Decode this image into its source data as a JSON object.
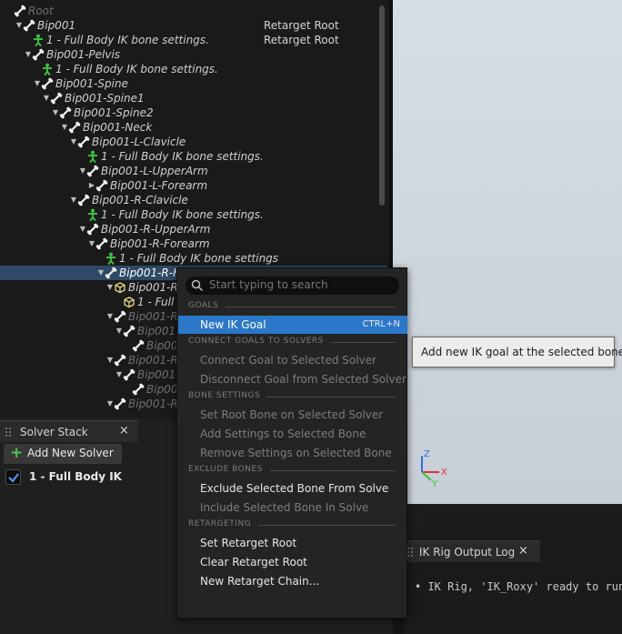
{
  "hierarchy": {
    "rows": [
      {
        "label": "Root",
        "depth": 0,
        "icon": "bone-icon",
        "arrow": "none",
        "dim": true
      },
      {
        "label": "Bip001",
        "depth": 1,
        "icon": "bone-icon",
        "arrow": "open",
        "goal_text": "Retarget Root"
      },
      {
        "label": "1 - Full Body IK bone settings.",
        "depth": 2,
        "icon": "bone-settings-icon",
        "arrow": "none",
        "goal_text": "Retarget Root"
      },
      {
        "label": "Bip001-Pelvis",
        "depth": 2,
        "icon": "bone-icon",
        "arrow": "open"
      },
      {
        "label": "1 - Full Body IK bone settings.",
        "depth": 3,
        "icon": "bone-settings-icon",
        "arrow": "none"
      },
      {
        "label": "Bip001-Spine",
        "depth": 3,
        "icon": "bone-icon",
        "arrow": "open"
      },
      {
        "label": "Bip001-Spine1",
        "depth": 4,
        "icon": "bone-icon",
        "arrow": "open"
      },
      {
        "label": "Bip001-Spine2",
        "depth": 5,
        "icon": "bone-icon",
        "arrow": "open"
      },
      {
        "label": "Bip001-Neck",
        "depth": 6,
        "icon": "bone-icon",
        "arrow": "open"
      },
      {
        "label": "Bip001-L-Clavicle",
        "depth": 7,
        "icon": "bone-icon",
        "arrow": "open"
      },
      {
        "label": "1 - Full Body IK bone settings.",
        "depth": 8,
        "icon": "bone-settings-icon",
        "arrow": "none"
      },
      {
        "label": "Bip001-L-UpperArm",
        "depth": 8,
        "icon": "bone-icon",
        "arrow": "open"
      },
      {
        "label": "Bip001-L-Forearm",
        "depth": 9,
        "icon": "bone-icon",
        "arrow": "closed"
      },
      {
        "label": "Bip001-R-Clavicle",
        "depth": 7,
        "icon": "bone-icon",
        "arrow": "open"
      },
      {
        "label": "1 - Full Body IK bone settings.",
        "depth": 8,
        "icon": "bone-settings-icon",
        "arrow": "none"
      },
      {
        "label": "Bip001-R-UpperArm",
        "depth": 8,
        "icon": "bone-icon",
        "arrow": "open"
      },
      {
        "label": "Bip001-R-Forearm",
        "depth": 9,
        "icon": "bone-icon",
        "arrow": "open"
      },
      {
        "label": "1 - Full Body IK bone settings",
        "depth": 10,
        "icon": "bone-settings-icon",
        "arrow": "none"
      },
      {
        "label": "Bip001-R-H",
        "depth": 10,
        "icon": "bone-icon",
        "arrow": "open",
        "selected": true
      },
      {
        "label": "Bip001-R",
        "depth": 11,
        "icon": "goal-cube-icon",
        "arrow": "open"
      },
      {
        "label": "1 - Full B",
        "depth": 12,
        "icon": "goal-cube-icon",
        "arrow": "none"
      },
      {
        "label": "Bip001-R",
        "depth": 11,
        "icon": "bone-icon",
        "arrow": "open",
        "dim": true
      },
      {
        "label": "Bip001-",
        "depth": 12,
        "icon": "bone-icon",
        "arrow": "open",
        "dim": true
      },
      {
        "label": "Bip001",
        "depth": 13,
        "icon": "bone-icon",
        "arrow": "none",
        "dim": true
      },
      {
        "label": "Bip001-R",
        "depth": 11,
        "icon": "bone-icon",
        "arrow": "open",
        "dim": true
      },
      {
        "label": "Bip001-",
        "depth": 12,
        "icon": "bone-icon",
        "arrow": "open",
        "dim": true
      },
      {
        "label": "Bip001",
        "depth": 13,
        "icon": "bone-icon",
        "arrow": "none",
        "dim": true
      },
      {
        "label": "Bip001-R",
        "depth": 11,
        "icon": "bone-icon",
        "arrow": "open",
        "dim": true
      }
    ]
  },
  "solver_stack": {
    "tab_title": "Solver Stack",
    "close_glyph": "×",
    "add_button_label": "Add New Solver",
    "add_glyph": "+",
    "solvers": [
      {
        "label": "1 - Full Body IK",
        "enabled": true
      }
    ]
  },
  "output_log": {
    "tab_title": "IK Rig Output Log",
    "close_glyph": "×",
    "lines": [
      "• IK Rig, 'IK_Roxy' ready to run"
    ]
  },
  "context_menu": {
    "search_placeholder": "Start typing to search",
    "sections": [
      {
        "title": "GOALS",
        "items": [
          {
            "label": "New IK Goal",
            "shortcut": "CTRL+N",
            "enabled": true,
            "highlighted": true
          }
        ]
      },
      {
        "title": "CONNECT GOALS TO SOLVERS",
        "items": [
          {
            "label": "Connect Goal to Selected Solver",
            "enabled": false
          },
          {
            "label": "Disconnect Goal from Selected Solver",
            "enabled": false
          }
        ]
      },
      {
        "title": "BONE SETTINGS",
        "items": [
          {
            "label": "Set Root Bone on Selected Solver",
            "enabled": false
          },
          {
            "label": "Add Settings to Selected Bone",
            "enabled": false
          },
          {
            "label": "Remove Settings on Selected Bone",
            "enabled": false
          }
        ]
      },
      {
        "title": "EXCLUDE BONES",
        "items": [
          {
            "label": "Exclude Selected Bone From Solve",
            "enabled": true
          },
          {
            "label": "Include Selected Bone In Solve",
            "enabled": false
          }
        ]
      },
      {
        "title": "RETARGETING",
        "items": [
          {
            "label": "Set Retarget Root",
            "enabled": true
          },
          {
            "label": "Clear Retarget Root",
            "enabled": true
          },
          {
            "label": "New Retarget Chain...",
            "enabled": true
          }
        ]
      }
    ]
  },
  "tooltip": {
    "text": "Add new IK goal at the selected bone."
  },
  "viewport": {
    "axis_labels": {
      "x": "X",
      "y": "Y",
      "z": "Z"
    }
  },
  "colors": {
    "selection": "#2e4a66",
    "menu_highlight": "#2b78c9",
    "bone_settings_green": "#3cbf3c",
    "goal_yellow": "#e8d77a",
    "axis_x": "#e0303a",
    "axis_y": "#3fbf3f",
    "axis_z": "#2f6fe0"
  }
}
